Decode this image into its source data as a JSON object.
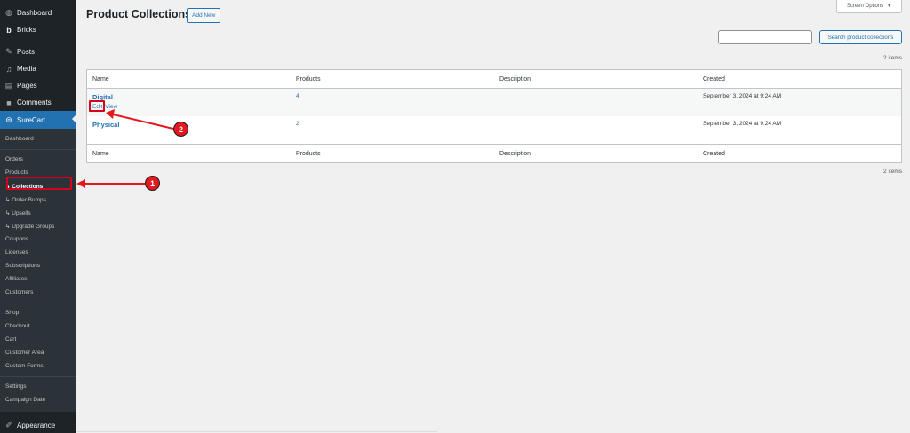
{
  "sidebar": {
    "top_items": [
      {
        "label": "Dashboard",
        "icon": "dashboard-icon"
      },
      {
        "label": "Bricks",
        "icon": "bricks-icon"
      },
      {
        "label": "Posts",
        "icon": "pin-icon"
      },
      {
        "label": "Media",
        "icon": "media-icon"
      },
      {
        "label": "Pages",
        "icon": "pages-icon"
      },
      {
        "label": "Comments",
        "icon": "comments-icon"
      },
      {
        "label": "SureCart",
        "icon": "surecart-icon"
      }
    ],
    "surecart_submenu": {
      "group1": [
        "Dashboard"
      ],
      "group2": [
        "Orders",
        "Products",
        "↳ Collections",
        "↳ Order Bumps",
        "↳ Upsells",
        "↳ Upgrade Groups",
        "Coupons",
        "Licenses",
        "Subscriptions",
        "Affiliates",
        "Customers"
      ],
      "group3": [
        "Shop",
        "Checkout",
        "Cart",
        "Customer Area",
        "Custom Forms"
      ],
      "group4": [
        "Settings",
        "Campaign Date"
      ]
    },
    "bottom_item": {
      "label": "Appearance",
      "icon": "brush-icon"
    }
  },
  "header": {
    "title": "Product Collections",
    "add_new": "Add New",
    "screen_options": "Screen Options",
    "screen_options_arrow": "▼"
  },
  "search": {
    "placeholder": "",
    "button": "Search product collections"
  },
  "count_top": "2 items",
  "count_bottom": "2 items",
  "table": {
    "columns": [
      "Name",
      "Products",
      "Description",
      "Created"
    ],
    "rows": [
      {
        "name": "Digital",
        "products": "4",
        "description": "",
        "created": "September 3, 2024 at 9:24 AM",
        "actions": [
          "Edit",
          "View"
        ]
      },
      {
        "name": "Physical",
        "products": "2",
        "description": "",
        "created": "September 3, 2024 at 9:24 AM",
        "actions": []
      }
    ]
  },
  "annotations": {
    "badge1": "1",
    "badge2": "2",
    "color": "#e5181f"
  }
}
